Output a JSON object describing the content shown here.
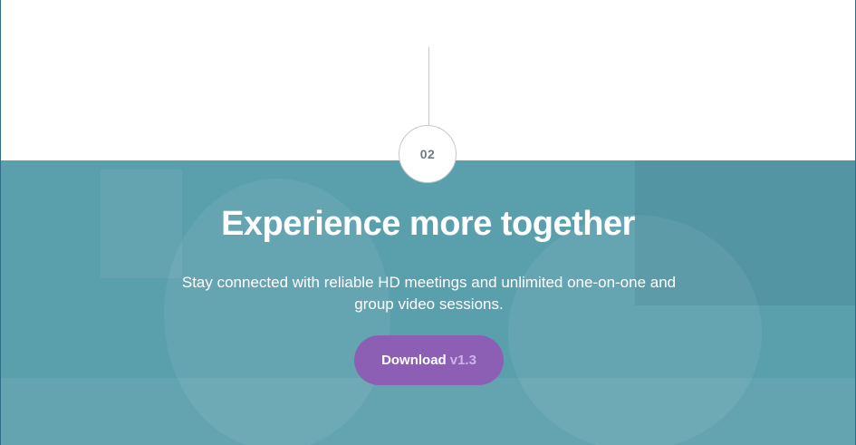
{
  "step": {
    "number": "02"
  },
  "hero": {
    "title": "Experience more together",
    "subtitle": "Stay connected with reliable HD meetings and unlimited one-on-one and group video sessions."
  },
  "download": {
    "label": "Download",
    "version": "v1.3"
  },
  "colors": {
    "hero_bg": "#5a9fac",
    "button_bg": "#8c5fb5",
    "version_text": "#cdb3ea",
    "step_text": "#6e7a86"
  }
}
